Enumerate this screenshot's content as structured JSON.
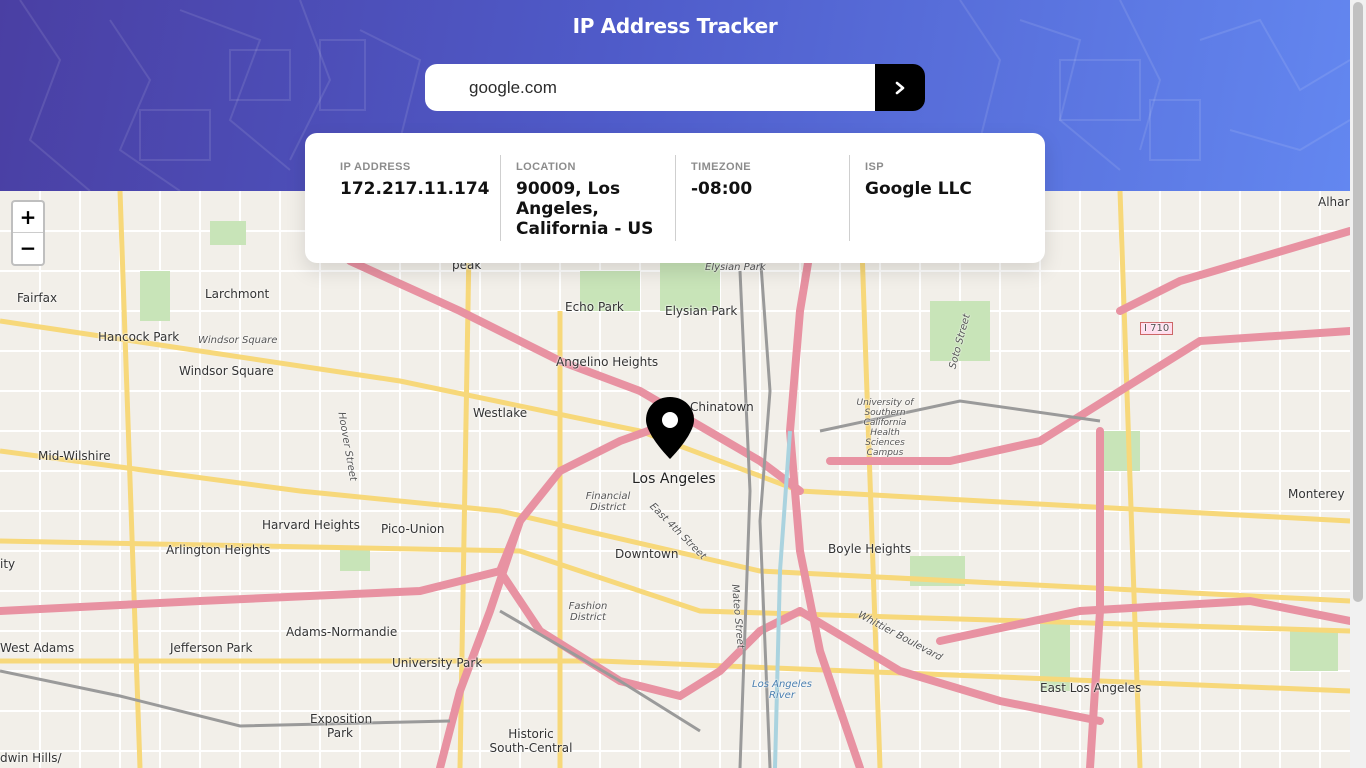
{
  "header": {
    "title": "IP Address Tracker"
  },
  "search": {
    "value": "google.com",
    "button_icon": "chevron-right-icon"
  },
  "info": {
    "ip_label": "IP ADDRESS",
    "ip_value": "172.217.11.174",
    "location_label": "LOCATION",
    "location_value": "90009, Los Angeles, California - US",
    "timezone_label": "TIMEZONE",
    "timezone_value": "-08:00",
    "isp_label": "ISP",
    "isp_value": "Google LLC"
  },
  "map": {
    "zoom_in": "+",
    "zoom_out": "−",
    "marker_icon": "location-pin-icon",
    "labels": {
      "fairfax": "Fairfax",
      "larchmont": "Larchmont",
      "hancock_park": "Hancock Park",
      "windsor_square": "Windsor Square",
      "windsor_square_small": "Windsor Square",
      "echo_park": "Echo Park",
      "elysian_park": "Elysian Park",
      "elysian_park_small": "Elysian Park",
      "angelino_heights": "Angelino Heights",
      "westlake": "Westlake",
      "chinatown": "Chinatown",
      "mid_wilshire": "Mid-Wilshire",
      "los_angeles": "Los Angeles",
      "financial_district": "Financial District",
      "harvard_heights": "Harvard Heights",
      "pico_union": "Pico-Union",
      "arlington_heights": "Arlington Heights",
      "downtown": "Downtown",
      "boyle_heights": "Boyle Heights",
      "usc_health": "University of Southern California Health Sciences Campus",
      "adams_normandie": "Adams-Normandie",
      "west_adams": "West Adams",
      "jefferson_park": "Jefferson Park",
      "university_park": "University Park",
      "fashion_district": "Fashion District",
      "exposition_park": "Exposition Park",
      "historic_south_central": "Historic South-Central",
      "baldwin_hills": "dwin Hills/",
      "east_los_angeles": "East Los Angeles",
      "monterey": "Monterey",
      "alhambra": "Alhar",
      "i710": "I 710",
      "whittier_blvd": "Whittier Boulevard",
      "soto_street": "Soto Street",
      "mateo_street": "Mateo Street",
      "los_angeles_river": "Los Angeles River",
      "east_4th": "East 4th Street",
      "hoover": "Hoover Street",
      "ity": "ity",
      "peak": "peak"
    }
  },
  "colors": {
    "accent": "#000000",
    "hero_start": "#4a3fa3",
    "hero_end": "#6387f0"
  }
}
